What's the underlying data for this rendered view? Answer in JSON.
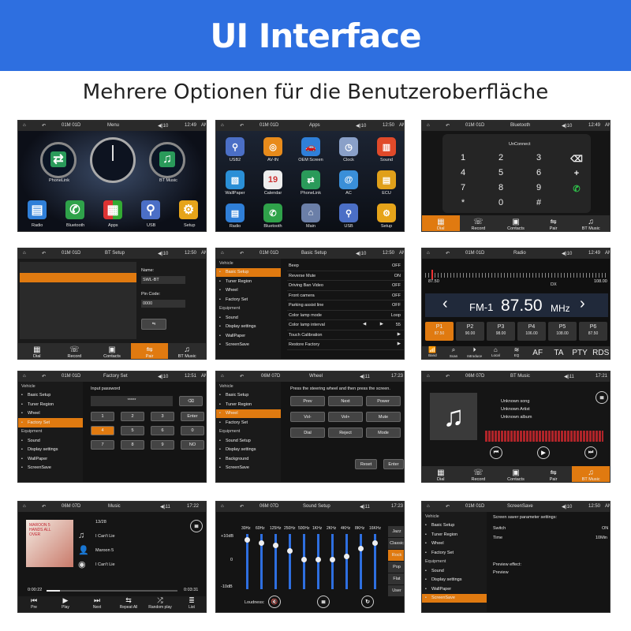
{
  "header": {
    "title": "UI Interface",
    "subtitle": "Mehrere Optionen für die Benutzeroberfläche"
  },
  "status": {
    "date1": "01M 01D",
    "date2": "06M 07D",
    "vol10": "◀)10",
    "vol11": "◀)11",
    "t1249": "12:49",
    "t1250": "12:50",
    "t1251": "12:51",
    "t1722": "17:22",
    "t1723": "17:23",
    "t1721": "17:21",
    "am": "AM"
  },
  "menu": {
    "title": "Menu",
    "phonelink": "PhoneLink",
    "btmusic": "BT Music",
    "dock": [
      "Radio",
      "Bluetooth",
      "Apps",
      "USB",
      "Setup"
    ]
  },
  "apps": {
    "title": "Apps",
    "items": [
      "USB2",
      "AV-IN",
      "OEM Screen",
      "Clock",
      "Sound",
      "WallPaper",
      "Calendar",
      "PhoneLink",
      "AC",
      "ECU",
      "Radio",
      "Bluetooth",
      "Main",
      "USB",
      "Setup"
    ],
    "cal": "19"
  },
  "bt": {
    "title": "Bluetooth",
    "unconnect": "UnConnect",
    "keys": [
      "1",
      "2",
      "3",
      "⌫",
      "4",
      "5",
      "6",
      "+",
      "7",
      "8",
      "9",
      "✆",
      "*",
      "0",
      "#"
    ],
    "nav": [
      "Dial",
      "Record",
      "Contacts",
      "Pair",
      "BT Music"
    ]
  },
  "btsetup": {
    "title": "BT Setup",
    "name_label": "Name:",
    "name": "SWL-BT",
    "pin_label": "Pin Code:",
    "pin": "0000",
    "nav": [
      "Dial",
      "Record",
      "Contacts",
      "Pair",
      "BT Music"
    ]
  },
  "basic": {
    "title": "Basic Setup",
    "side": [
      "Vehicle",
      "Basic Setup",
      "Tuner Region",
      "Wheel",
      "Factory Set",
      "Equipment",
      "Sound",
      "Display settings",
      "WallPaper",
      "ScreenSave"
    ],
    "rows": [
      [
        "Beep",
        "OFF"
      ],
      [
        "Reverse Mute",
        "ON"
      ],
      [
        "Driving Ban Video",
        "OFF"
      ],
      [
        "Front camera",
        "OFF"
      ],
      [
        "Parking assist line",
        "OFF"
      ],
      [
        "Color lamp mode",
        "Loop"
      ],
      [
        "Color lamp interval",
        "55"
      ],
      [
        "Touch Calibration",
        ""
      ],
      [
        "Restore Factory",
        ""
      ]
    ]
  },
  "radio": {
    "title": "Radio",
    "lo": "87.50",
    "hi": "108.00",
    "dx": "DX",
    "band": "FM-1",
    "freq": "87.50",
    "unit": "MHz",
    "presets": [
      [
        "P1",
        "87.50"
      ],
      [
        "P2",
        "90.00"
      ],
      [
        "P3",
        "98.00"
      ],
      [
        "P4",
        "106.00"
      ],
      [
        "P5",
        "108.00"
      ],
      [
        "P6",
        "87.50"
      ]
    ],
    "bottom": [
      "Band",
      "Scan",
      "Introduce",
      "Local",
      "EQ",
      "AF",
      "TA",
      "PTY",
      "RDS"
    ]
  },
  "factory": {
    "title": "Factory Set",
    "label": "Input password",
    "value": "*****",
    "side": [
      "Vehicle",
      "Basic Setup",
      "Tuner Region",
      "Wheel",
      "Factory Set",
      "Equipment",
      "Sound",
      "Display settings",
      "WallPaper",
      "ScreenSave"
    ],
    "keys": [
      "1",
      "2",
      "3",
      "Enter",
      "4",
      "5",
      "6",
      "0",
      "7",
      "8",
      "9",
      "NO"
    ]
  },
  "wheel": {
    "title": "Wheel",
    "hint": "Press the steering wheel and then press the screen.",
    "side": [
      "Vehicle",
      "Basic Setup",
      "Tuner Region",
      "Wheel",
      "Factory Set",
      "Equipment",
      "Sound Setup",
      "Display settings",
      "Background",
      "ScreenSave"
    ],
    "buttons": [
      "Prev",
      "Next",
      "Power",
      "Vol-",
      "Vol+",
      "Mute",
      "Dial",
      "Reject",
      "Mode"
    ],
    "reset": "Reset",
    "enter": "Enter"
  },
  "btmusic": {
    "title": "BT Music",
    "song": "Unknown song",
    "artist": "Unknown Artist",
    "album": "Unknown album",
    "nav": [
      "Dial",
      "Record",
      "Contacts",
      "Pair",
      "BT Music"
    ]
  },
  "music": {
    "title": "Music",
    "track": "13/28",
    "song": "I Can't Lie",
    "artist": "Maroon 5",
    "album": "I Can't Lie",
    "cover": "MAROON 5 HANDS ALL OVER",
    "cur": "0:00:22",
    "total": "0:03:31",
    "progress": 0.1,
    "controls": [
      "Pre",
      "Play",
      "Next",
      "Repeat All",
      "Random play",
      "List"
    ]
  },
  "sound": {
    "title": "Sound Setup",
    "bands": [
      "30Hz",
      "60Hz",
      "125Hz",
      "250Hz",
      "500Hz",
      "1KHz",
      "2KHz",
      "4KHz",
      "8KHz",
      "16KHz"
    ],
    "levels": [
      0.9,
      0.85,
      0.8,
      0.7,
      0.55,
      0.55,
      0.55,
      0.6,
      0.75,
      0.85
    ],
    "ytop": "+10dB",
    "ymid": "0",
    "ybot": "-10dB",
    "loud": "Loudness:",
    "presets": [
      "Jazz",
      "Classic",
      "Rock",
      "Pop",
      "Flat",
      "User"
    ]
  },
  "saver": {
    "title": "ScreenSave",
    "side": [
      "Vehicle",
      "Basic Setup",
      "Tuner Region",
      "Wheel",
      "Factory Set",
      "Equipment",
      "Sound",
      "Display settings",
      "WallPaper",
      "ScreenSave"
    ],
    "head": "Screen saver parameter settings:",
    "sw": "Switch",
    "swv": "ON",
    "time": "Time",
    "timev": "10Min",
    "effect": "Preview effect:",
    "preview": "Preview"
  },
  "colors": {
    "accent": "#e07a10",
    "blue": "#2e6fe0"
  }
}
